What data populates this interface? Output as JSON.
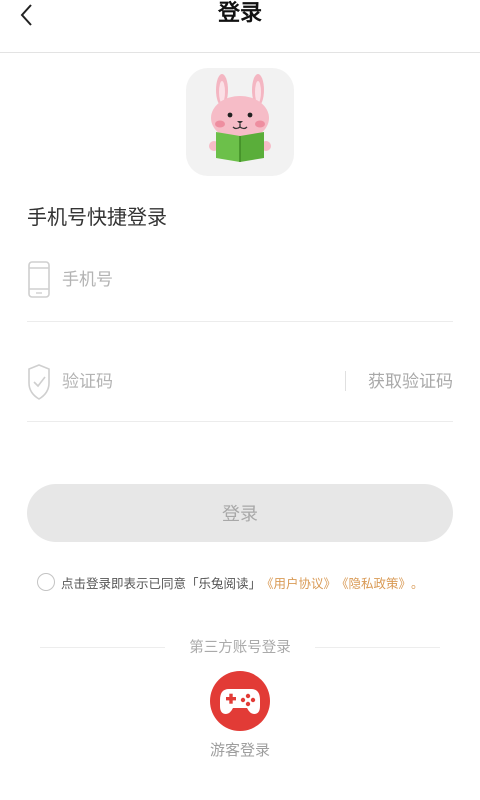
{
  "header": {
    "title": "登录",
    "back_icon": "chevron-left-icon"
  },
  "logo": {
    "icon": "rabbit-reading-book-icon"
  },
  "section_title": "手机号快捷登录",
  "phone": {
    "placeholder": "手机号",
    "value": "",
    "icon": "phone-icon"
  },
  "code": {
    "placeholder": "验证码",
    "value": "",
    "icon": "shield-check-icon",
    "get_code_label": "获取验证码"
  },
  "login_button": "登录",
  "agreement": {
    "checked": false,
    "text": "点击登录即表示已同意「乐兔阅读」",
    "user_agreement": "《用户协议》",
    "privacy_policy": "《隐私政策》",
    "end": "。"
  },
  "third_party": {
    "title": "第三方账号登录",
    "guest_label": "游客登录",
    "guest_icon": "gamepad-icon"
  },
  "colors": {
    "accent": "#e23b36",
    "link": "#d99a55",
    "button_bg": "#e7e7e7"
  }
}
